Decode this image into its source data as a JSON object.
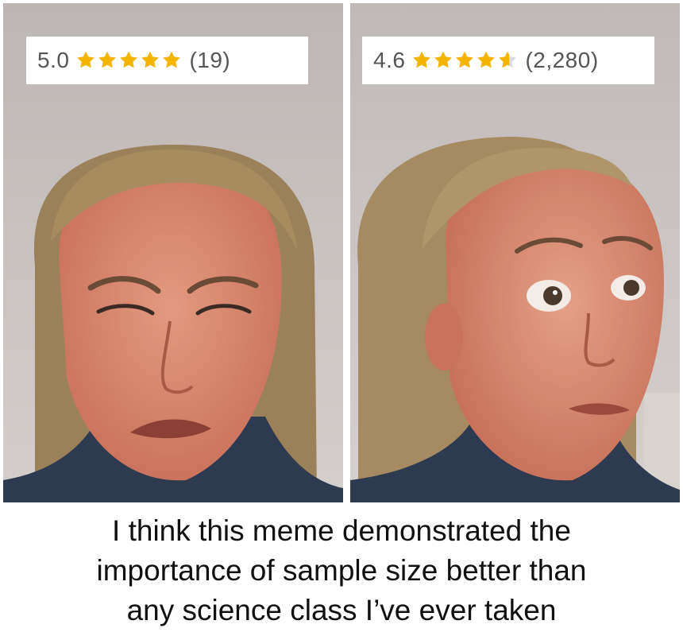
{
  "panels": {
    "left": {
      "score": "5.0",
      "stars_filled": 5,
      "star_count": 5,
      "review_count": "(19)"
    },
    "right": {
      "score": "4.6",
      "stars_filled": 4.6,
      "star_count": 5,
      "review_count": "(2,280)"
    }
  },
  "caption": {
    "lines": [
      "I think this meme demonstrated the",
      "importance of sample size better than",
      "any science class I’ve ever taken"
    ]
  },
  "colors": {
    "star_fill": "#f5b400",
    "star_empty": "#d9d9d9",
    "rating_text": "#555555",
    "caption_text": "#111111",
    "wall": "#c8c2bf",
    "skin": "#d9866f",
    "hair": "#9b8159"
  }
}
